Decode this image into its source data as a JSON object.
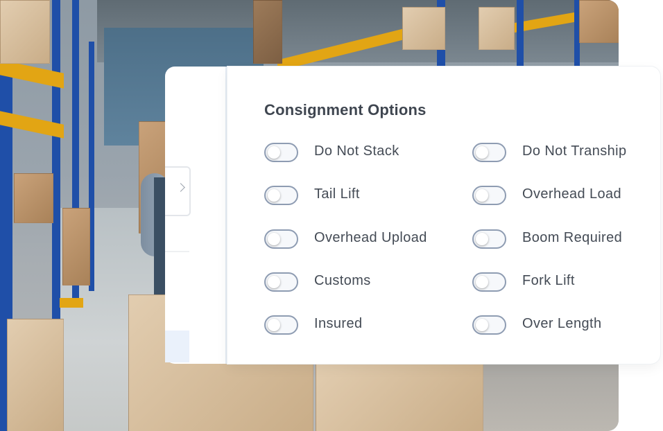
{
  "panel": {
    "title": "Consignment Options",
    "options_left": [
      {
        "label": "Do Not Stack",
        "on": false
      },
      {
        "label": "Tail Lift",
        "on": false
      },
      {
        "label": "Overhead Upload",
        "on": false
      },
      {
        "label": "Customs",
        "on": false
      },
      {
        "label": "Insured",
        "on": false
      }
    ],
    "options_right": [
      {
        "label": "Do Not Tranship",
        "on": false
      },
      {
        "label": "Overhead Load",
        "on": false
      },
      {
        "label": "Boom Required",
        "on": false
      },
      {
        "label": "Fork Lift",
        "on": false
      },
      {
        "label": "Over Length",
        "on": false
      }
    ]
  },
  "colors": {
    "toggle_border": "#8e9cb2",
    "title_text": "#3f4650",
    "label_text": "#444b55",
    "rack_blue": "#1f4fa8",
    "beam_yellow": "#e2a514"
  }
}
